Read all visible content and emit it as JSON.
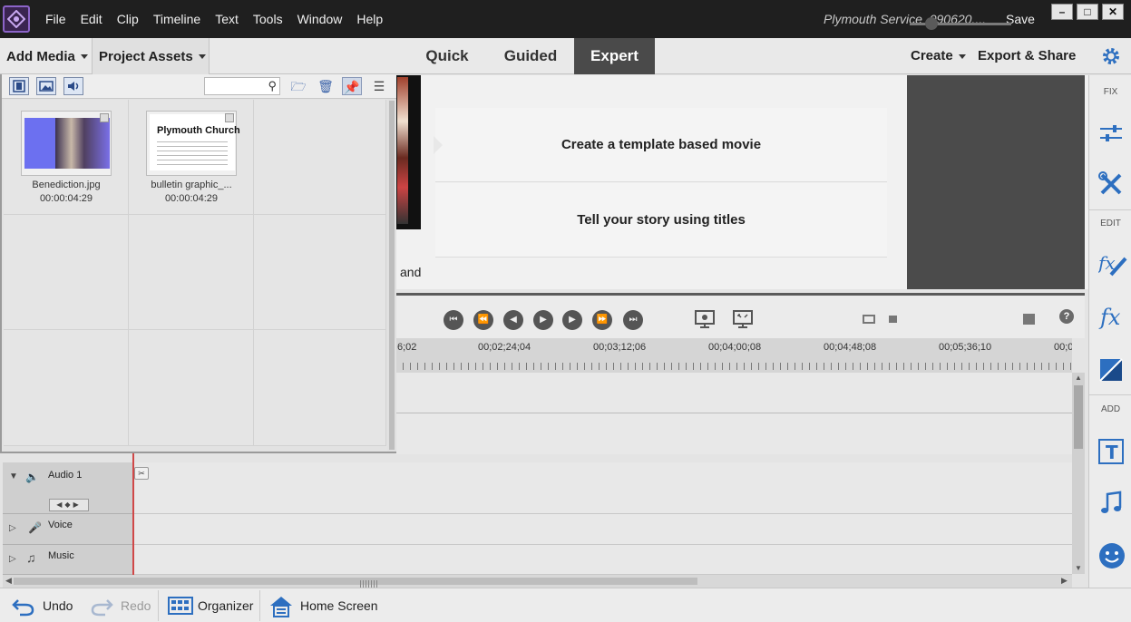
{
  "app": {
    "project_name": "Plymouth Service_090620....",
    "save_label": "Save",
    "menu": [
      "File",
      "Edit",
      "Clip",
      "Timeline",
      "Text",
      "Tools",
      "Window",
      "Help"
    ]
  },
  "modebar": {
    "add_media": "Add Media",
    "project_assets": "Project Assets",
    "tabs": [
      "Quick",
      "Guided",
      "Expert"
    ],
    "active_tab": "Expert",
    "create": "Create",
    "export_share": "Export & Share"
  },
  "guided": {
    "items": [
      "Create a template based movie",
      "Tell your story using titles"
    ],
    "partial_text": "and"
  },
  "timeline": {
    "ruler_labels": [
      "6;02",
      "00;02;24;04",
      "00;03;12;06",
      "00;04;00;08",
      "00;04;48;08",
      "00;05;36;10",
      "00;0"
    ],
    "tracks": [
      {
        "name": "Audio 1",
        "icon": "speaker-icon"
      },
      {
        "name": "Voice",
        "icon": "microphone-icon"
      },
      {
        "name": "Music",
        "icon": "music-note-icon"
      }
    ]
  },
  "assets": {
    "items": [
      {
        "name": "Benediction.jpg",
        "duration": "00:00:04:29"
      },
      {
        "name": "bulletin graphic_...",
        "duration": "00:00:04:29",
        "thumb_title": "Plymouth Church"
      }
    ]
  },
  "right_panel": {
    "sections": [
      "FIX",
      "EDIT",
      "ADD"
    ],
    "icons": [
      "adjust-sliders-icon",
      "tools-icon",
      "fx-edit-icon",
      "fx-icon",
      "transitions-icon",
      "titles-icon",
      "music-icon",
      "graphics-icon"
    ]
  },
  "bottombar": {
    "undo": "Undo",
    "redo": "Redo",
    "organizer": "Organizer",
    "home_screen": "Home Screen"
  },
  "colors": {
    "titlebar": "#1f1f1f",
    "accent_blue": "#2d6fc0",
    "playhead": "#d04848",
    "active_tab": "#4a4a4a"
  }
}
